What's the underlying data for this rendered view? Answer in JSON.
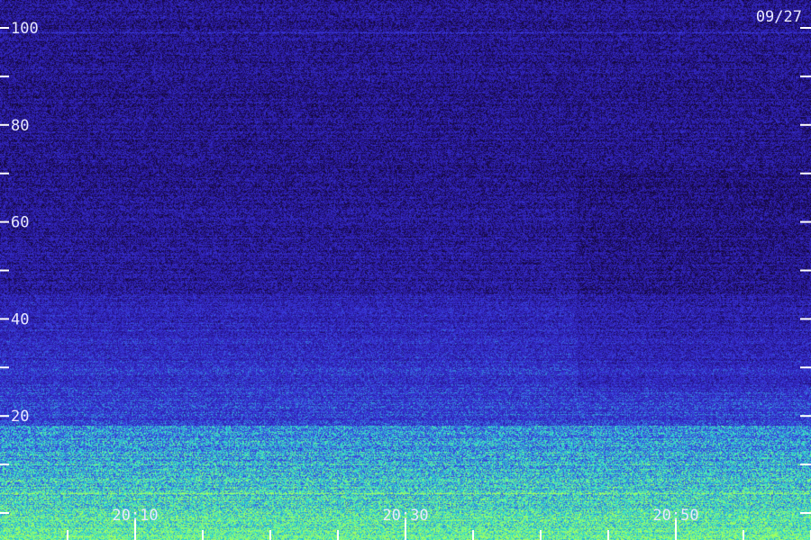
{
  "chart_data": {
    "type": "heatmap",
    "title": "",
    "xlabel": "",
    "ylabel": "",
    "date_label": "09/27",
    "ylim": [
      0,
      100
    ],
    "y_ticks_labeled": [
      20,
      40,
      60,
      80,
      100
    ],
    "y_ticks_minor": [
      0,
      10,
      30,
      50,
      70,
      90
    ],
    "x_time_range": [
      "20:02",
      "21:02"
    ],
    "x_ticks_labeled": [
      "20:10",
      "20:30",
      "20:50"
    ],
    "x_ticks_major": [
      "20:10",
      "20:30",
      "20:50"
    ],
    "x_ticks_minor": [
      "20:05",
      "20:15",
      "20:20",
      "20:25",
      "20:35",
      "20:40",
      "20:45",
      "20:55",
      "21:00"
    ],
    "intensity_bands": [
      {
        "from": 0,
        "to": 18,
        "level": "high"
      },
      {
        "from": 18,
        "to": 45,
        "level": "medium"
      },
      {
        "from": 45,
        "to": 100,
        "level": "low"
      }
    ],
    "persistent_lines": [
      99,
      4
    ],
    "colors": {
      "background": "#14083a",
      "low": "#2a18a0",
      "medium": "#3a3ae0",
      "high": "#30e0d0",
      "peak": "#a0ff60"
    }
  }
}
